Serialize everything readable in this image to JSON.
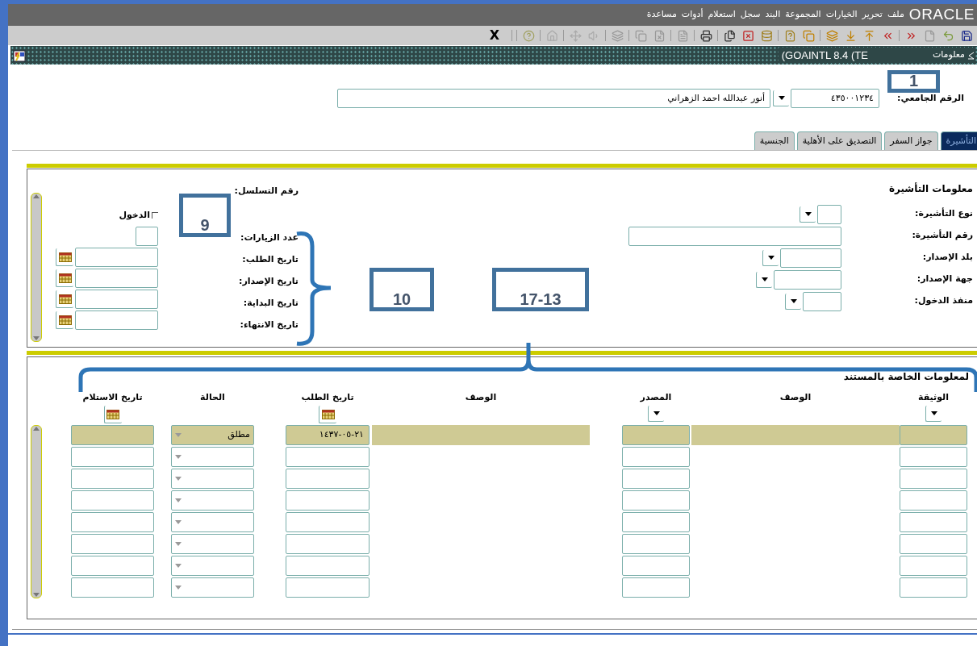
{
  "menu_bar": {
    "logo": "ORACLE",
    "items": [
      "ملف",
      "تحرير",
      "الخيارات",
      "المجموعة",
      "البند",
      "سجل",
      "استعلام",
      "أدوات",
      "مساعدة"
    ]
  },
  "toolbar": {
    "close_label": "X"
  },
  "window": {
    "title_arabic": "معلومات",
    "title": "(GOAINTL 8.4 (TE"
  },
  "key_block": {
    "label": "الرقم الجامعي:",
    "id_value": "٤٣٥٠٠١٢٣٤",
    "name_value": "أنور عبدالله احمد الزهراني"
  },
  "tabs": [
    {
      "label": "التأشيرة",
      "selected": true
    },
    {
      "label": "جواز السفر",
      "selected": false
    },
    {
      "label": "التصديق على الأهلية",
      "selected": false
    },
    {
      "label": "الجنسية",
      "selected": false
    }
  ],
  "visa_block": {
    "title": "معلومات التأشيرة",
    "fields": [
      {
        "label": "نوع التأشيرة:",
        "kind": "list"
      },
      {
        "label": "رقم التأشيرة:",
        "kind": "text"
      },
      {
        "label": "بلد الإصدار:",
        "kind": "list"
      },
      {
        "label": "جهة الإصدار:",
        "kind": "list"
      },
      {
        "label": "منفذ الدخول:",
        "kind": "list"
      }
    ],
    "sequence_label": "رقم التسلسل:",
    "entry": {
      "label": "الدخول",
      "checked": false
    },
    "details": [
      {
        "label": "عدد الزيارات:",
        "kind": "number"
      },
      {
        "label": "تاريخ الطلب:",
        "kind": "date"
      },
      {
        "label": "تاريخ الإصدار:",
        "kind": "date"
      },
      {
        "label": "تاريخ البداية:",
        "kind": "date"
      },
      {
        "label": "تاريخ الانتهاء:",
        "kind": "date"
      }
    ]
  },
  "document_block": {
    "title": "لمعلومات الخاصة بالمستند",
    "columns": [
      {
        "label": "الوثيقة",
        "kind": "document",
        "list_button": true
      },
      {
        "label": "الوصف",
        "kind": "description"
      },
      {
        "label": "المصدر",
        "kind": "source",
        "list_button": true
      },
      {
        "label": "الوصف",
        "kind": "description"
      },
      {
        "label": "تاريخ الطلب",
        "kind": "requested",
        "calendar_button": true
      },
      {
        "label": "الحالة",
        "kind": "status"
      },
      {
        "label": "تاريخ الاستلام",
        "kind": "received",
        "calendar_button": true
      }
    ],
    "rows": [
      {
        "selected": true,
        "requested": "١٤٣٧-٠٥-٢١",
        "status": "مطلق"
      },
      {
        "selected": false
      },
      {
        "selected": false
      },
      {
        "selected": false
      },
      {
        "selected": false
      },
      {
        "selected": false
      },
      {
        "selected": false
      },
      {
        "selected": false
      }
    ]
  },
  "annotations": [
    {
      "label": "1"
    },
    {
      "label": "9"
    },
    {
      "label": "10"
    },
    {
      "label": "17-13"
    }
  ]
}
